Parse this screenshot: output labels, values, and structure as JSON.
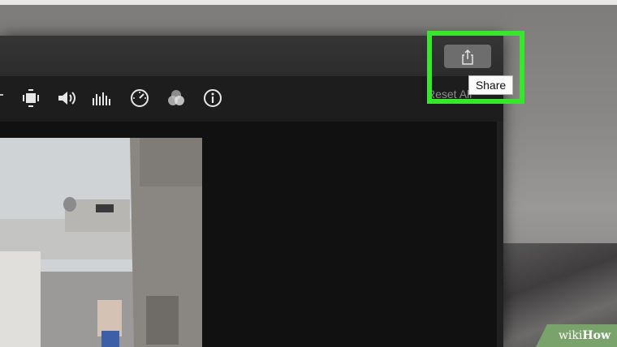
{
  "toolbar": {
    "items": [
      {
        "name": "crop-icon"
      },
      {
        "name": "volume-icon"
      },
      {
        "name": "equalizer-icon"
      },
      {
        "name": "speed-icon"
      },
      {
        "name": "color-filters-icon"
      },
      {
        "name": "info-icon"
      }
    ],
    "reset_all_label": "Reset All"
  },
  "share": {
    "icon": "share-icon",
    "tooltip": "Share",
    "highlight_color": "#39e62e"
  },
  "watermark": {
    "prefix": "wiki",
    "suffix": "How"
  }
}
